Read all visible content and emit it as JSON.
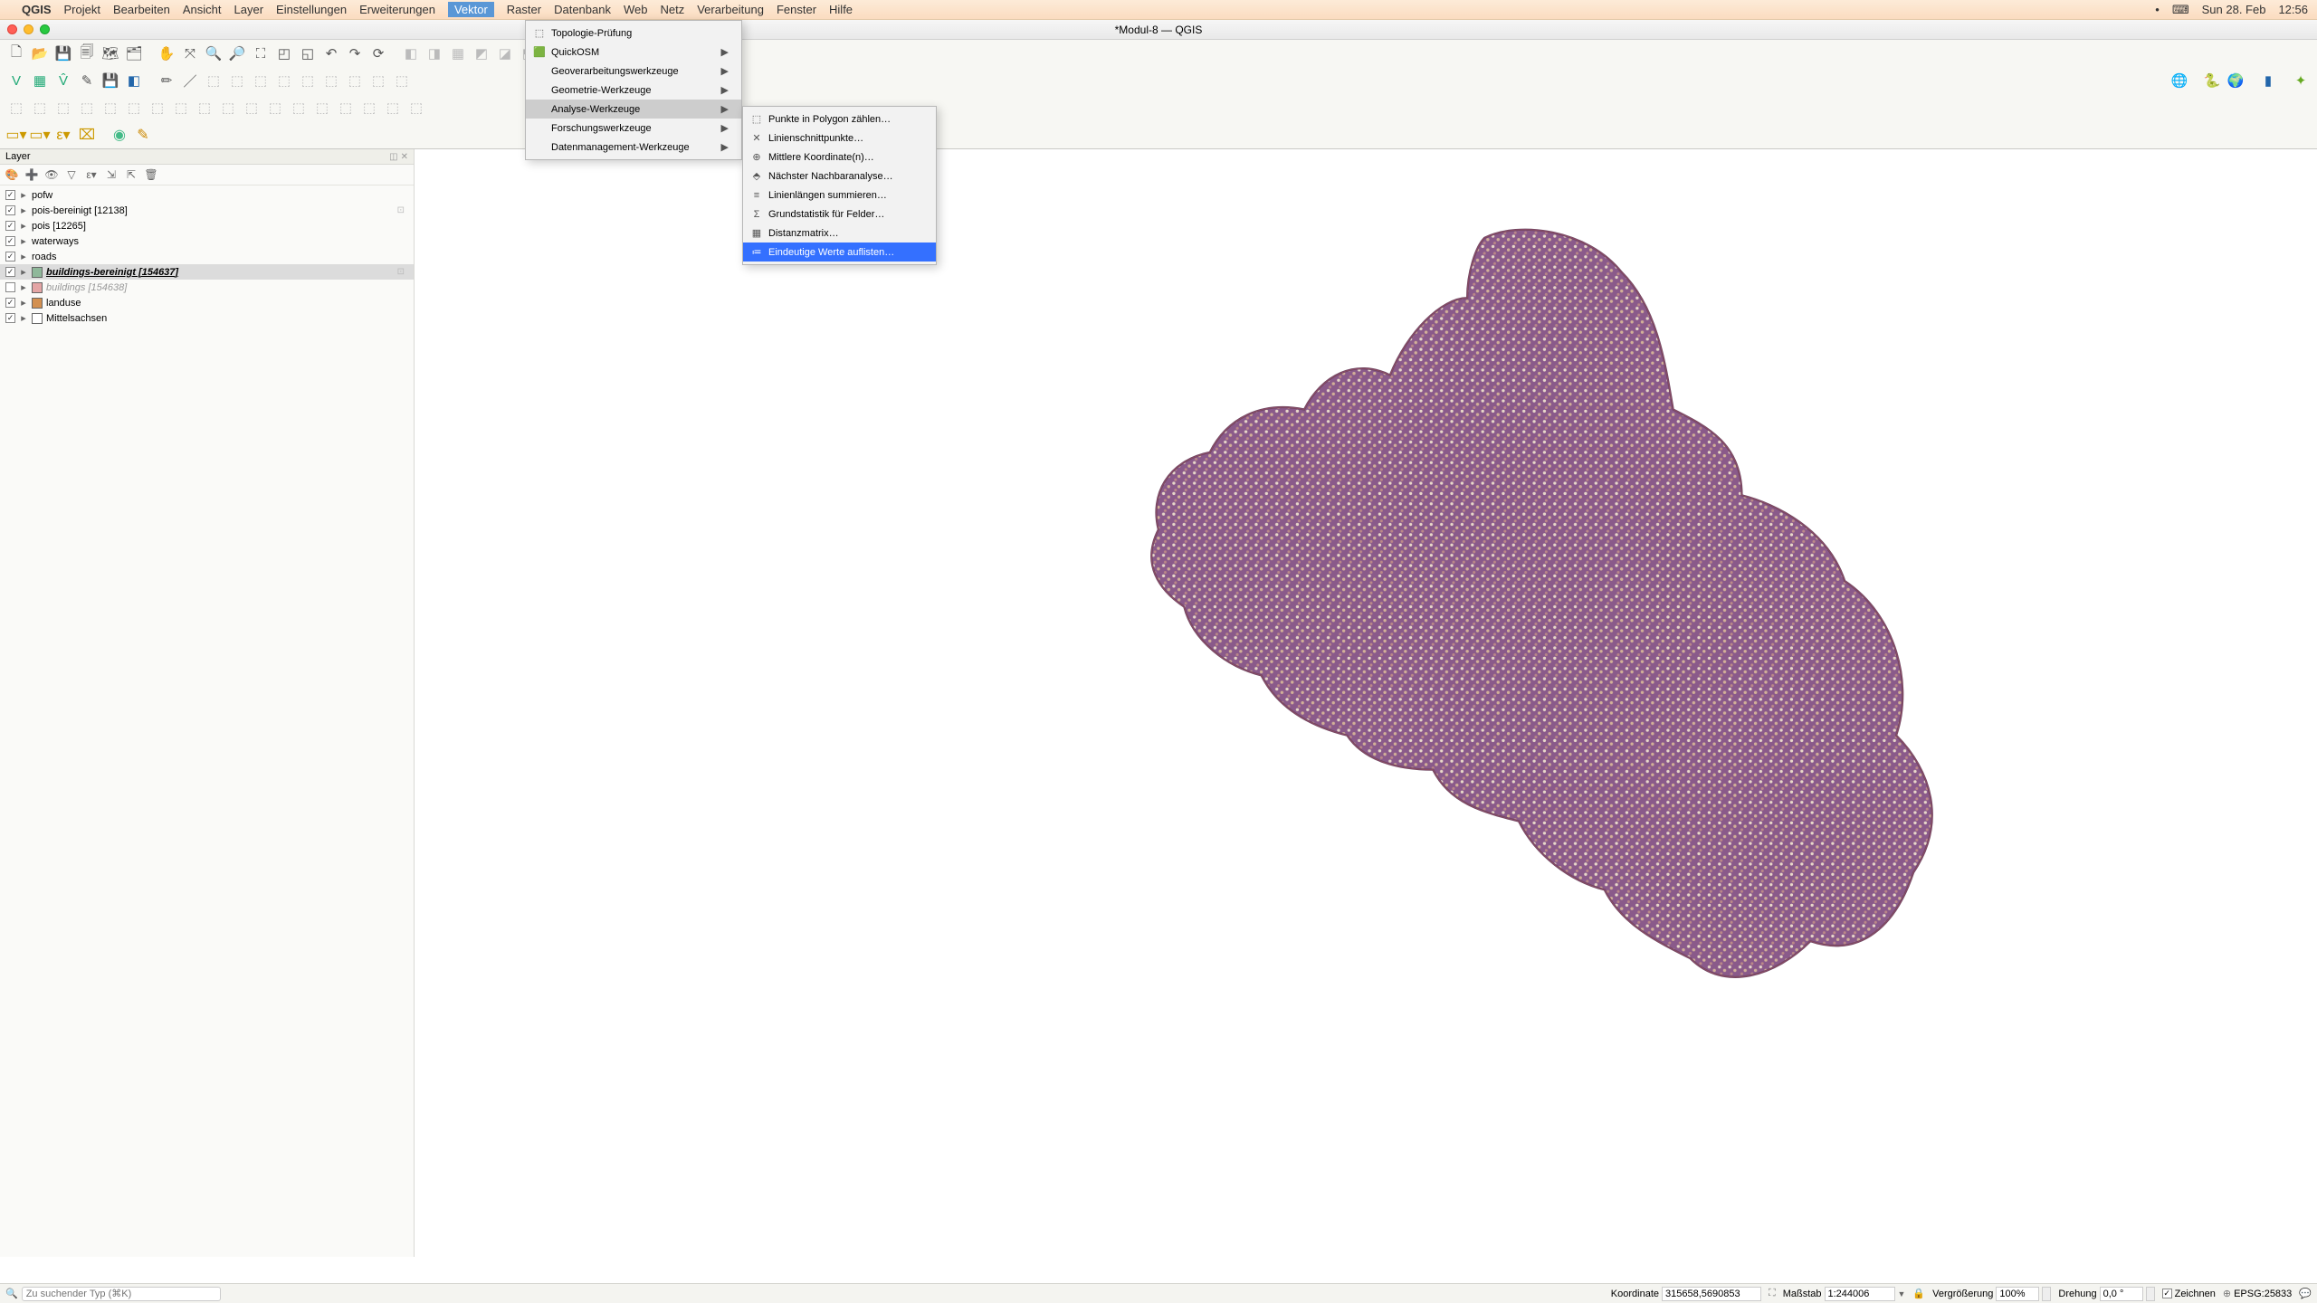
{
  "mac_menubar": {
    "app": "QGIS",
    "items": [
      "Projekt",
      "Bearbeiten",
      "Ansicht",
      "Layer",
      "Einstellungen",
      "Erweiterungen",
      "Vektor",
      "Raster",
      "Datenbank",
      "Web",
      "Netz",
      "Verarbeitung",
      "Fenster",
      "Hilfe"
    ],
    "active_index": 6,
    "date": "Sun 28. Feb",
    "time": "12:56"
  },
  "window_title": "*Modul-8 — QGIS",
  "vektor_menu": {
    "items": [
      {
        "label": "Topologie-Prüfung",
        "submenu": false,
        "icon": "topology"
      },
      {
        "label": "QuickOSM",
        "submenu": true,
        "icon": "osm"
      },
      {
        "label": "Geoverarbeitungswerkzeuge",
        "submenu": true
      },
      {
        "label": "Geometrie-Werkzeuge",
        "submenu": true
      },
      {
        "label": "Analyse-Werkzeuge",
        "submenu": true,
        "highlighted": true
      },
      {
        "label": "Forschungswerkzeuge",
        "submenu": true
      },
      {
        "label": "Datenmanagement-Werkzeuge",
        "submenu": true
      }
    ]
  },
  "analyse_submenu": {
    "items": [
      {
        "label": "Punkte in Polygon zählen…",
        "icon": "points-polygon"
      },
      {
        "label": "Linienschnittpunkte…",
        "icon": "line-intersect"
      },
      {
        "label": "Mittlere Koordinate(n)…",
        "icon": "mean-coord"
      },
      {
        "label": "Nächster Nachbaranalyse…",
        "icon": "nearest"
      },
      {
        "label": "Linienlängen summieren…",
        "icon": "line-sum"
      },
      {
        "label": "Grundstatistik für Felder…",
        "icon": "stats"
      },
      {
        "label": "Distanzmatrix…",
        "icon": "matrix"
      },
      {
        "label": "Eindeutige Werte auflisten…",
        "icon": "unique",
        "selected": true
      }
    ]
  },
  "layers_panel": {
    "title": "Layer",
    "items": [
      {
        "checked": true,
        "expand": "▸",
        "type": "point",
        "name": "pofw"
      },
      {
        "checked": true,
        "expand": "▸",
        "type": "point",
        "name": "pois-bereinigt [12138]",
        "badge": "⊡"
      },
      {
        "checked": true,
        "expand": "▸",
        "type": "point",
        "name": "pois [12265]"
      },
      {
        "checked": true,
        "expand": "▸",
        "type": "line",
        "name": "waterways"
      },
      {
        "checked": true,
        "expand": "▸",
        "type": "line",
        "name": "roads"
      },
      {
        "checked": true,
        "expand": "▸",
        "type": "poly",
        "color": "#8fb89a",
        "name": "buildings-bereinigt [154637]",
        "selected": true,
        "bolditalic": true,
        "badge": "⊡"
      },
      {
        "checked": false,
        "expand": "▸",
        "type": "poly",
        "color": "#e4a5a5",
        "name": "buildings [154638]",
        "dim": true
      },
      {
        "checked": true,
        "expand": "▸",
        "type": "poly",
        "color": "#d39050",
        "name": "landuse"
      },
      {
        "checked": true,
        "expand": "▸",
        "type": "poly",
        "color": "#fff",
        "name": "Mittelsachsen"
      }
    ]
  },
  "statusbar": {
    "search_placeholder": "Zu suchender Typ (⌘K)",
    "coord_label": "Koordinate",
    "coord_value": "315658,5690853",
    "scale_label": "Maßstab",
    "scale_value": "1:244006",
    "magnifier_label": "Vergrößerung",
    "magnifier_value": "100%",
    "rotation_label": "Drehung",
    "rotation_value": "0,0 °",
    "render_label": "Zeichnen",
    "crs_label": "EPSG:25833"
  }
}
